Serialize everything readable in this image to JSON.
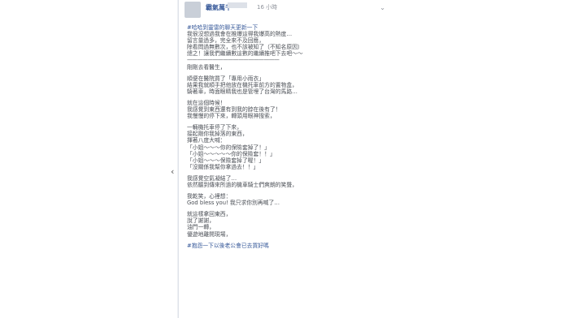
{
  "post": {
    "author": "霸氣萬千",
    "time": "16 小時",
    "scroll_marker": "‹",
    "chevron": "⌄",
    "lines": [
      {
        "text": "#哈哈到靈雷的聊天更新一下",
        "tag": true
      },
      {
        "text": "我很沒想過我會在推爆這得我爆高的熱度…"
      },
      {
        "text": "留言量過多，完全來不及回應，"
      },
      {
        "text": "除看問過無數次，也不該被知了（不知名原因）"
      },
      {
        "text": "總之！讓我們繼續數這數的繼續推吧下去吧～～"
      },
      {
        "text": "——————————————————",
        "divider": true
      },
      {
        "text": "剛剛去看醫生，",
        "gap": true
      },
      {
        "text": "順便在醫院買了「專用小雨衣」"
      },
      {
        "text": "結果我就順手把他放在機托車前方的置物盒，"
      },
      {
        "text": "騎著車，時面眼睛我也是管埋了台灣的馬路…",
        "gap": true
      },
      {
        "text": "就在這個時候！"
      },
      {
        "text": "我感覺到東西還有到我的脖在後有了！"
      },
      {
        "text": "我慢慢的停下來，轉頭用眼神搜索，",
        "gap": true
      },
      {
        "text": "一輛機托車停了下來，"
      },
      {
        "text": "接起剛你我掉落的東西，"
      },
      {
        "text": "揮著八度大喊："
      },
      {
        "text": "「小姐～～～你的保險套掉了！」"
      },
      {
        "text": "「小姐～～～～～你的保險套！！」"
      },
      {
        "text": "「小姐～～～保險套掉了喔！」"
      },
      {
        "text": "「沒關係我幫你拿過去！！」",
        "gap": true
      },
      {
        "text": "我感覺空氣凝結了…"
      },
      {
        "text": "依然聽到傳來所過的機車騎士們爽朗的笑聲，",
        "gap": true
      },
      {
        "text": "我乾笑，心裡想："
      },
      {
        "text": "God bless you! 我只求你別再喊了…",
        "gap": true
      },
      {
        "text": "就這樣拿回東西，"
      },
      {
        "text": "說了謝謝，"
      },
      {
        "text": "油門一轉，"
      },
      {
        "text": "優遊地離開現場，",
        "gap": true
      },
      {
        "text": "#抱怨一下以後老公會已去買好嗎",
        "tag": true
      }
    ]
  }
}
